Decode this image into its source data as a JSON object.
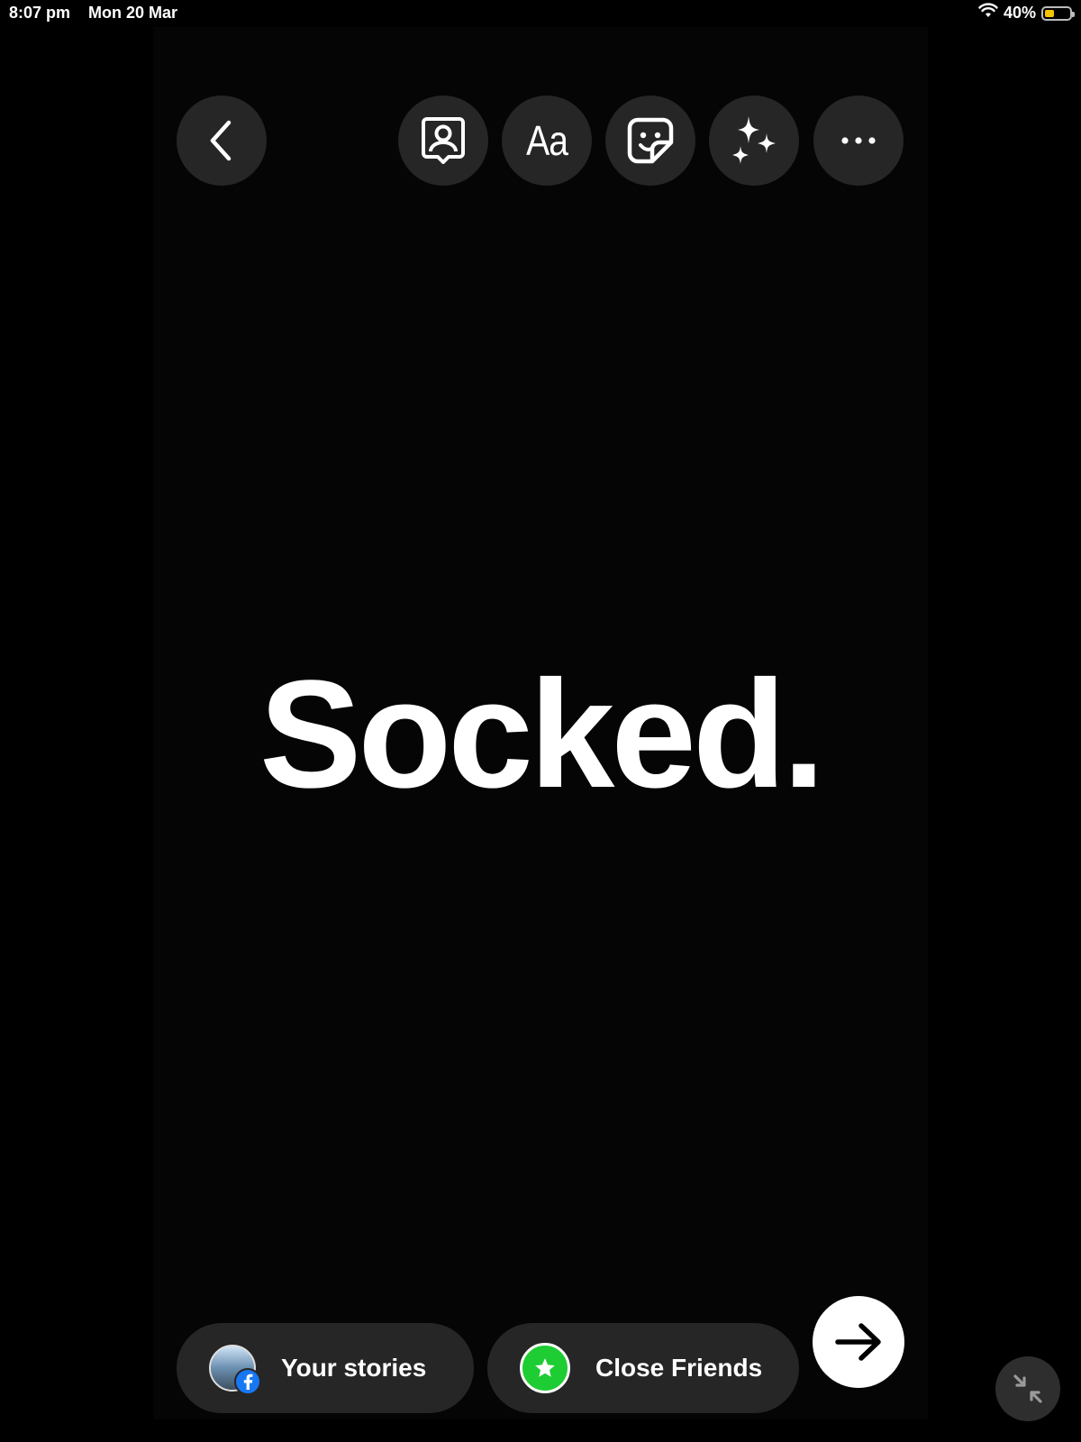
{
  "status_bar": {
    "time": "8:07 pm",
    "date": "Mon 20 Mar",
    "battery_percent": "40%",
    "battery_level": 0.4,
    "battery_color": "#f5c400"
  },
  "toolbar": {
    "back_icon": "chevron-left-icon",
    "tag_people_icon": "tag-people-icon",
    "text_label": "Aa",
    "sticker_icon": "sticker-icon",
    "effects_icon": "sparkles-icon",
    "more_icon": "more-horizontal-icon"
  },
  "story": {
    "text": "Socked."
  },
  "share": {
    "your_stories_label": "Your stories",
    "close_friends_label": "Close Friends",
    "close_friends_color": "#1ecc33",
    "next_icon": "arrow-right-icon",
    "facebook_icon": "facebook-icon",
    "star_icon": "star-icon"
  },
  "minimize_icon": "minimize-arrows-icon"
}
